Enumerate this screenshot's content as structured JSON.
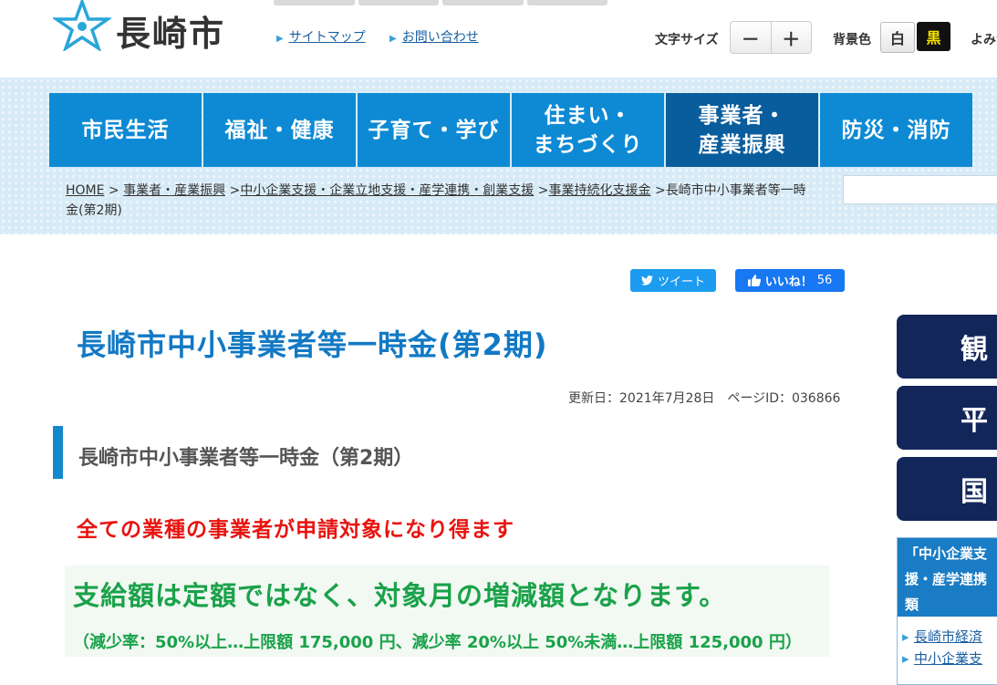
{
  "header": {
    "logo_text": "長崎市",
    "links": [
      "サイトマップ",
      "お問い合わせ"
    ],
    "font_size_label": "文字サイズ",
    "font_size_minus": "－",
    "font_size_plus": "＋",
    "bg_color_label": "背景色",
    "bg_white": "白",
    "bg_black": "黒",
    "reading_label": "よみが"
  },
  "nav": {
    "items": [
      {
        "label": "市民生活",
        "active": false
      },
      {
        "label": "福祉・健康",
        "active": false
      },
      {
        "label": "子育て・学び",
        "active": false
      },
      {
        "label": "住まい・\nまちづくり",
        "active": false
      },
      {
        "label": "事業者・\n産業振興",
        "active": true
      },
      {
        "label": "防災・消防",
        "active": false
      }
    ]
  },
  "breadcrumb": {
    "items": [
      "HOME",
      "事業者・産業振興",
      "中小企業支援・企業立地支援・産学連携・創業支援",
      "事業持続化支援金"
    ],
    "current": "長崎市中小事業者等一時金(第2期)"
  },
  "social": {
    "tweet": "ツイート",
    "like": "いいね！",
    "like_count": "56"
  },
  "main": {
    "title": "長崎市中小事業者等一時金(第2期)",
    "updated": "更新日：2021年7月28日　ページID：036866",
    "heading": "長崎市中小事業者等一時金（第2期）",
    "notice": "全ての業種の事業者が申請対象になり得ます",
    "highlight": "支給額は定額ではなく、対象月の増減額となります。",
    "highlight_sub": "（減少率：50%以上…上限額 175,000 円、減少率 20%以上 50%未満…上限額 125,000 円）"
  },
  "sidebar": {
    "buttons": [
      "観光",
      "平和",
      "国際"
    ],
    "box_title_lines": [
      "「中小企業支",
      "援・産学連携",
      "類"
    ],
    "links": [
      "長崎市経済",
      "中小企業支"
    ]
  },
  "colors": {
    "nav_blue": "#0e8ad4",
    "nav_active": "#0a5d9c",
    "title_blue": "#1279c4",
    "notice_red": "#e8130f",
    "highlight_green": "#1aa24a",
    "side_navy": "#13265a"
  }
}
